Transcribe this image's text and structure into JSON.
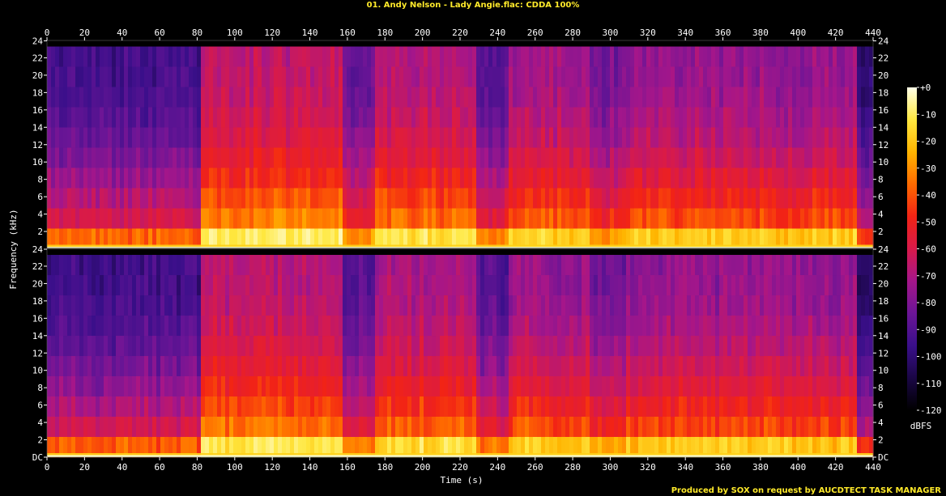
{
  "title": "01. Andy Nelson - Lady Angie.flac: CDDA 100%",
  "footer": "Produced by SOX on request by AUCDTECT TASK MANAGER",
  "colors": {
    "title": "#ffea2a",
    "background": "#000000",
    "palette": [
      "#000000",
      "#1a0645",
      "#3a0f8a",
      "#6b1596",
      "#a5168a",
      "#d81a4a",
      "#f22315",
      "#ff6a00",
      "#ffb400",
      "#ffe840",
      "#ffffe8"
    ]
  },
  "chart_data": {
    "type": "heatmap",
    "subtype": "spectrogram",
    "channels": 2,
    "xlabel": "Time (s)",
    "ylabel": "Frequency (kHz)",
    "xlim": [
      0,
      440
    ],
    "ylim": [
      0,
      24
    ],
    "x_ticks": [
      "0",
      "20",
      "40",
      "60",
      "80",
      "100",
      "120",
      "140",
      "160",
      "180",
      "200",
      "220",
      "240",
      "260",
      "280",
      "300",
      "320",
      "340",
      "360",
      "380",
      "400",
      "420",
      "440"
    ],
    "y_ticks_upper": [
      "24",
      "22",
      "20",
      "18",
      "16",
      "14",
      "12",
      "10",
      "8",
      "6",
      "4",
      "2"
    ],
    "y_ticks_lower": [
      "24",
      "22",
      "20",
      "18",
      "16",
      "14",
      "12",
      "10",
      "8",
      "6",
      "4",
      "2",
      "DC"
    ],
    "frequency_cutoff_khz": 23.3,
    "colorbar": {
      "label": "dBFS",
      "range": [
        -120,
        0
      ],
      "ticks": [
        "+0",
        "-10",
        "-20",
        "-30",
        "-40",
        "-50",
        "-60",
        "-70",
        "-80",
        "-90",
        "-100",
        "-110",
        "-120"
      ]
    },
    "intensity_segments": [
      {
        "start": 0,
        "end": 83,
        "level": 0.35
      },
      {
        "start": 83,
        "end": 158,
        "level": 0.72
      },
      {
        "start": 158,
        "end": 175,
        "level": 0.45
      },
      {
        "start": 175,
        "end": 228,
        "level": 0.68
      },
      {
        "start": 228,
        "end": 246,
        "level": 0.42
      },
      {
        "start": 246,
        "end": 290,
        "level": 0.63
      },
      {
        "start": 290,
        "end": 308,
        "level": 0.5
      },
      {
        "start": 308,
        "end": 432,
        "level": 0.6
      },
      {
        "start": 432,
        "end": 444,
        "level": 0.25
      }
    ]
  }
}
